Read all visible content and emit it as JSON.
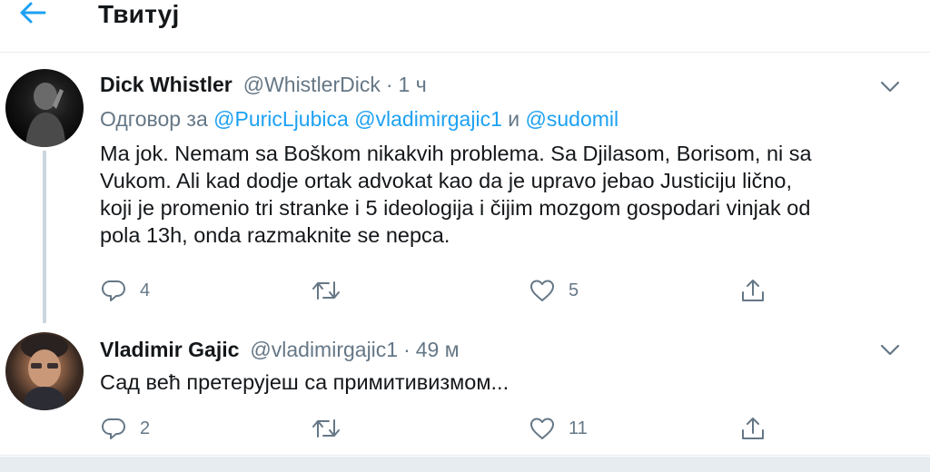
{
  "header": {
    "title": "Твитуј",
    "back_icon": "arrow-left-icon"
  },
  "colors": {
    "accent": "#1da1f2",
    "secondary_text": "#657786",
    "divider": "#e6ecf0"
  },
  "tweets": [
    {
      "display_name": "Dick Whistler",
      "handle": "@WhistlerDick",
      "dot": "·",
      "time": "1 ч",
      "reply": {
        "prefix": "Одговор за",
        "mentions": [
          "@PuricLjubica",
          "@vladimirgajic1",
          "@sudomil"
        ],
        "and": "и"
      },
      "text_lines": [
        "Ma jok. Nemam sa Boškom nikakvih problema. Sa Djilasom, Borisom, ni sa",
        "Vukom. Ali kad dodje ortak advokat kao da je upravo jebao Justiciju lično,",
        "koji je promenio tri stranke i 5 ideologija i čijim mozgom gospodari vinjak od",
        "pola 13h, onda razmaknite se nepca."
      ],
      "replies": "4",
      "retweets": "",
      "likes": "5"
    },
    {
      "display_name": "Vladimir Gajic",
      "handle": "@vladimirgajic1",
      "dot": "·",
      "time": "49 м",
      "text_lines": [
        "Сад већ претерујеш са примитивизмом..."
      ],
      "replies": "2",
      "retweets": "",
      "likes": "11"
    }
  ]
}
